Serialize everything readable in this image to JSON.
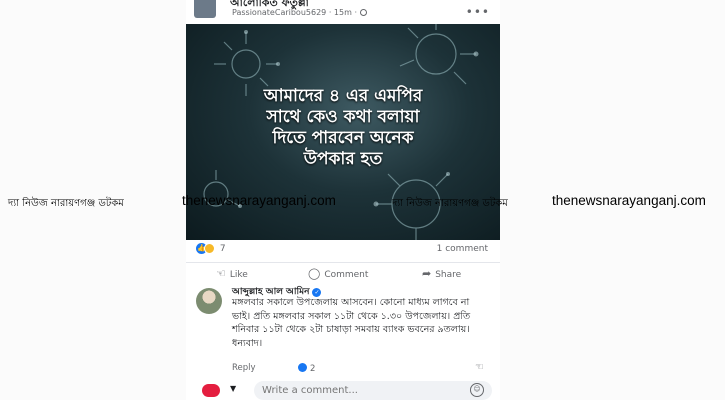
{
  "post": {
    "group_name": "আলোকিত ফতুল্লা",
    "author": "PassionateCaribou5629",
    "time": "15m",
    "image_caption_lines": [
      "আমাদের ৪ এর এমপির",
      "সাথে কেও কথা বলায়া",
      "দিতে পারবেন অনেক",
      "উপকার হত"
    ],
    "reaction_count": "7",
    "comment_count": "1 comment",
    "actions": {
      "like": "Like",
      "comment": "Comment",
      "share": "Share"
    }
  },
  "comment": {
    "author": "আব্দুল্লাহ আল আমিন",
    "text": "মঙ্গলবার সকালে উপজেলায় আসবেন। কোনো মাধ্যম লাগবে না ভাই। প্রতি মঙ্গলবার সকাল ১১টা থেকে ১.৩০ উপজেলায়। প্রতি শনিবার ১১টা থেকে ২টা চাষাড়া সমবায় ব্যাংক ভবনের ৯তলায়। ধন্যবাদ।",
    "reply_label": "Reply",
    "like_count": "2"
  },
  "composer": {
    "placeholder": "Write a comment..."
  },
  "watermark": {
    "bangla": "দ্যা নিউজ নারায়ণগঞ্জ ডটকম",
    "english": "thenewsnarayanganj.com"
  },
  "colors": {
    "accent": "#1877f2",
    "record": "#e41e3f"
  },
  "icons": [
    "globe-icon",
    "more-icon",
    "like-icon",
    "comment-icon",
    "share-icon",
    "verified-icon",
    "thumb-icon",
    "emoji-icon"
  ]
}
